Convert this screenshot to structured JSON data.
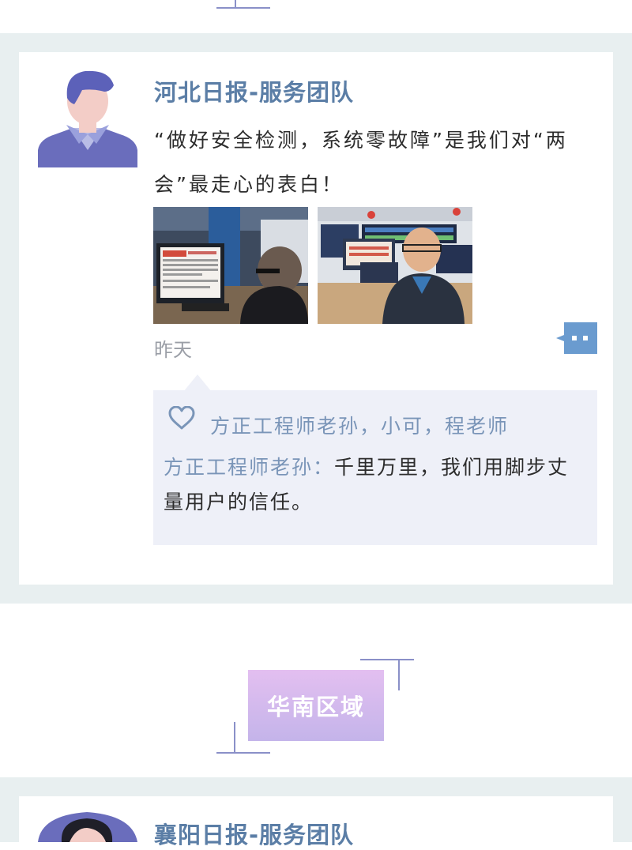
{
  "posts": [
    {
      "team": "河北日报-服务团队",
      "text": "“做好安全检测，系统零故障”是我们对“两会”最走心的表白！",
      "time": "昨天",
      "likes": "方正工程师老孙，小可，程老师",
      "comment_author": "方正工程师老孙：",
      "comment_text": "千里万里，我们用脚步丈量用户的信任。"
    },
    {
      "team": "襄阳日报-服务团队"
    }
  ],
  "region": {
    "label": "华南区域"
  },
  "colors": {
    "accent": "#5b7ea6",
    "band": "#e8eff0",
    "comment_bg": "#eef0f8",
    "badge_top": "#e3bff0",
    "badge_bottom": "#c4b4ea"
  }
}
